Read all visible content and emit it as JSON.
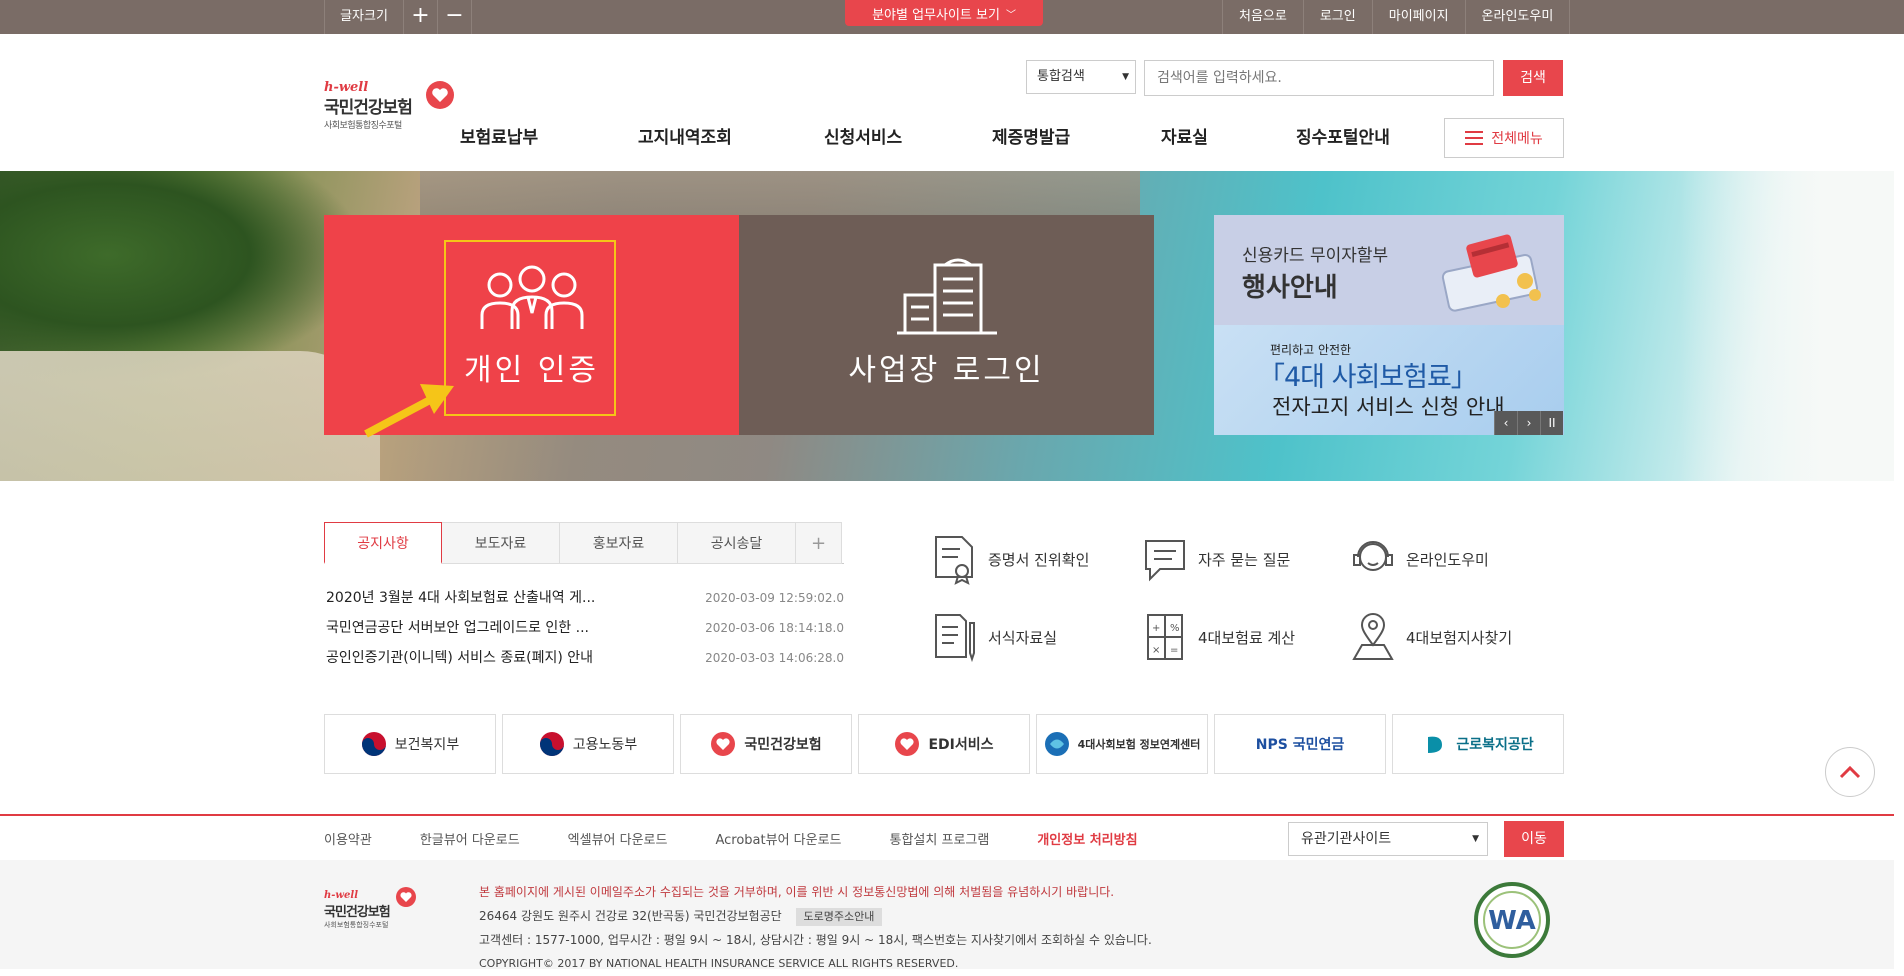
{
  "topbar": {
    "font_size_label": "글자크기",
    "increase": "+",
    "decrease": "−",
    "center_link": "분야별 업무사이트 보기",
    "links": [
      "처음으로",
      "로그인",
      "마이페이지",
      "온라인도우미"
    ]
  },
  "header": {
    "logo_hwell": "h-well",
    "logo_title": "국민건강보험",
    "logo_sub": "사회보험통합징수포털",
    "search_select": "통합검색",
    "search_placeholder": "검색어를 입력하세요.",
    "search_button": "검색",
    "nav": [
      "보험료납부",
      "고지내역조회",
      "신청서비스",
      "제증명발급",
      "자료실",
      "징수포털안내"
    ],
    "all_menu": "전체메뉴"
  },
  "hero": {
    "personal_label": "개인 인증",
    "business_label": "사업장 로그인",
    "banner1_line1": "신용카드 무이자할부",
    "banner1_line2": "행사안내",
    "banner2_line1": "편리하고 안전한",
    "banner2_line2": "「4대 사회보험료」",
    "banner2_line3": "전자고지 서비스 신청 안내",
    "controls": [
      "‹",
      "›",
      "II"
    ]
  },
  "notice": {
    "tabs": [
      "공지사항",
      "보도자료",
      "홍보자료",
      "공시송달",
      "+"
    ],
    "items": [
      {
        "title": "2020년 3월분 4대 사회보험료 산출내역 게...",
        "date": "2020-03-09 12:59:02.0"
      },
      {
        "title": "국민연금공단 서버보안 업그레이드로 인한 ...",
        "date": "2020-03-06 18:14:18.0"
      },
      {
        "title": "공인인증기관(이니텍) 서비스 종료(폐지) 안내",
        "date": "2020-03-03 14:06:28.0"
      }
    ]
  },
  "quick": {
    "items": [
      "증명서 진위확인",
      "자주 묻는 질문",
      "온라인도우미",
      "서식자료실",
      "4대보험료 계산",
      "4대보험지사찾기"
    ]
  },
  "orgs": [
    "보건복지부",
    "고용노동부",
    "국민건강보험",
    "EDI서비스",
    "4대사회보험 정보연계센터",
    "NPS 국민연금",
    "근로복지공단"
  ],
  "footer": {
    "links": [
      "이용약관",
      "한글뷰어 다운로드",
      "엑셀뷰어 다운로드",
      "Acrobat뷰어 다운로드",
      "통합설치 프로그램",
      "개인정보 처리방침"
    ],
    "related_select": "유관기관사이트",
    "move_button": "이동",
    "warning": "본 홈페이지에 게시된 이메일주소가 수집되는 것을 거부하며, 이를 위반 시 정보통신망법에 의해 처벌됨을 유념하시기 바랍니다.",
    "address": "26464 강원도 원주시 건강로 32(반곡동) 국민건강보험공단",
    "address_button": "도로명주소안내",
    "contact": "고객센터 : 1577-1000, 업무시간 : 평일 9시 ~ 18시, 상담시간 : 평일 9시 ~ 18시, 팩스번호는 지사찾기에서 조회하실 수 있습니다.",
    "copyright": "COPYRIGHT© 2017 BY NATIONAL HEALTH INSURANCE SERVICE ALL RIGHTS RESERVED.",
    "wa_text": "WA"
  },
  "colors": {
    "accent": "#e8464c",
    "topbar": "#7a6c66",
    "business": "#6e5d56"
  }
}
